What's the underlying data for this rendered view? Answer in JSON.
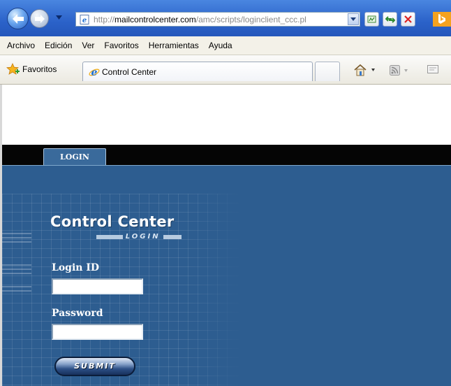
{
  "browser": {
    "url": {
      "prefix": "http://",
      "host": "mailcontrolcenter.com",
      "path": "/amc/scripts/loginclient_ccc.pl"
    },
    "menu": [
      "Archivo",
      "Edición",
      "Ver",
      "Favoritos",
      "Herramientas",
      "Ayuda"
    ],
    "favorites_label": "Favoritos",
    "tab_title": "Control Center",
    "icons": {
      "back": "back-arrow-icon",
      "forward": "forward-arrow-icon",
      "compat": "compatibility-view-icon",
      "refresh": "refresh-icon",
      "stop": "stop-icon",
      "search": "bing-icon",
      "home": "home-icon",
      "feeds": "rss-feed-icon",
      "mail": "read-mail-icon"
    }
  },
  "page": {
    "nav_tab": "LOGIN",
    "brand_title": "Control Center",
    "brand_subtitle": "LOGIN",
    "login_id_label": "Login ID",
    "login_id_value": "",
    "password_label": "Password",
    "password_value": "",
    "submit_label": "SUBMIT",
    "colors": {
      "page_blue": "#2d5d90",
      "tab_blue": "#3a6a9b",
      "black_bar": "#050505"
    }
  }
}
